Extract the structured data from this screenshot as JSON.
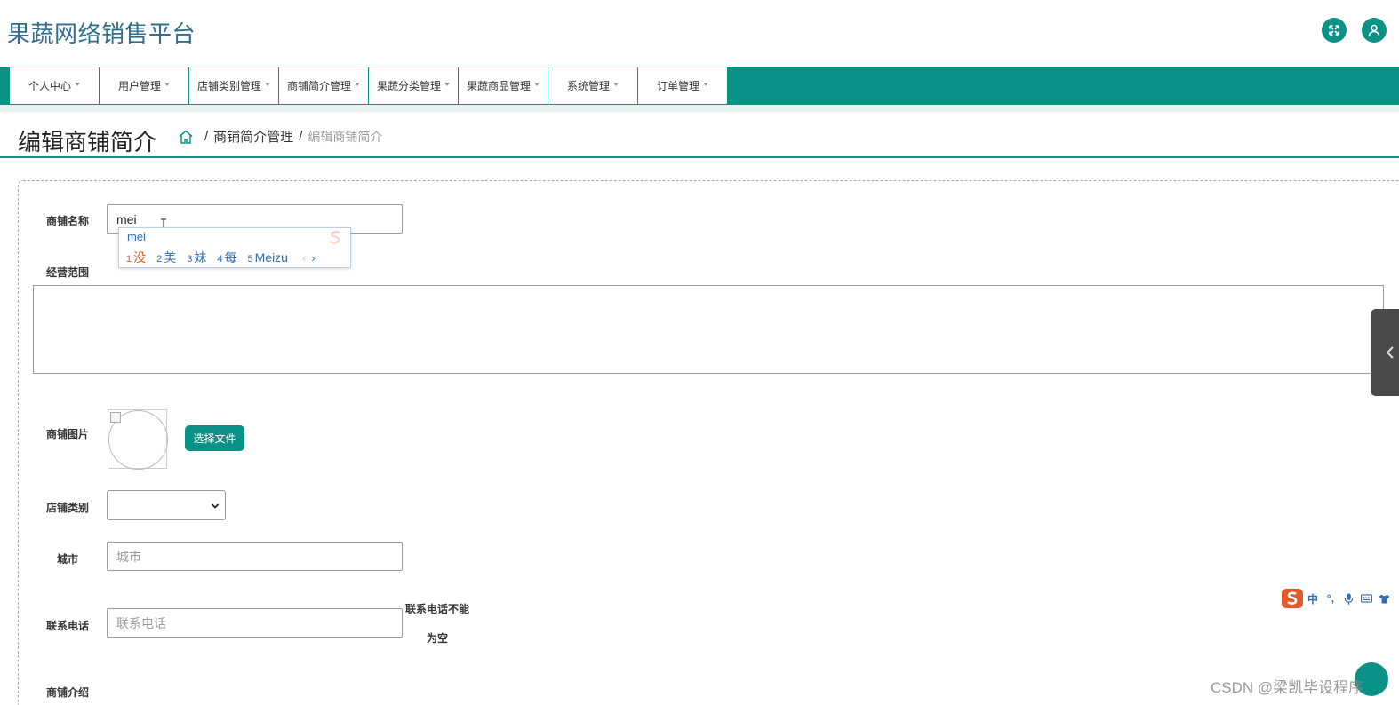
{
  "header": {
    "site_title": "果蔬网络销售平台",
    "fullscreen_icon": "expand-arrows-icon",
    "user_icon": "user-icon"
  },
  "nav": {
    "items": [
      {
        "label": "个人中心"
      },
      {
        "label": "用户管理"
      },
      {
        "label": "店铺类别管理"
      },
      {
        "label": "商铺简介管理"
      },
      {
        "label": "果蔬分类管理"
      },
      {
        "label": "果蔬商品管理"
      },
      {
        "label": "系统管理"
      },
      {
        "label": "订单管理"
      }
    ],
    "caret_icon": "caret-down-icon"
  },
  "page": {
    "title": "编辑商铺简介",
    "breadcrumb": {
      "home_icon": "home-icon",
      "sep": "/",
      "section": "商铺简介管理",
      "current": "编辑商铺简介"
    }
  },
  "form": {
    "shop_name": {
      "label": "商铺名称",
      "value": "mei"
    },
    "business_scope": {
      "label": "经营范围",
      "value": ""
    },
    "shop_image": {
      "label": "商铺图片",
      "button": "选择文件"
    },
    "shop_category": {
      "label": "店铺类别",
      "value": ""
    },
    "city": {
      "label": "城市",
      "placeholder": "城市"
    },
    "phone": {
      "label": "联系电话",
      "placeholder": "联系电话",
      "hint_line1": "联系电话不能",
      "hint_line2": "为空"
    },
    "intro": {
      "label": "商铺介绍"
    }
  },
  "ime": {
    "composition": "mei",
    "candidates": [
      {
        "num": "1",
        "text": "没"
      },
      {
        "num": "2",
        "text": "美"
      },
      {
        "num": "3",
        "text": "妹"
      },
      {
        "num": "4",
        "text": "每"
      },
      {
        "num": "5",
        "text": "Meizu"
      }
    ],
    "prev": "‹",
    "next": "›"
  },
  "ime_toolbar": {
    "mode": "中",
    "punct": "°,",
    "icons": [
      "sogou-logo-icon",
      "mode-icon",
      "punctuation-icon",
      "microphone-icon",
      "keyboard-icon",
      "skin-icon"
    ]
  },
  "watermark": "CSDN @梁凯毕设程序",
  "colors": {
    "primary": "#0b9286",
    "title": "#2f6e8e",
    "ime_blue": "#2f6fb6",
    "ime_active": "#e25b2a"
  }
}
